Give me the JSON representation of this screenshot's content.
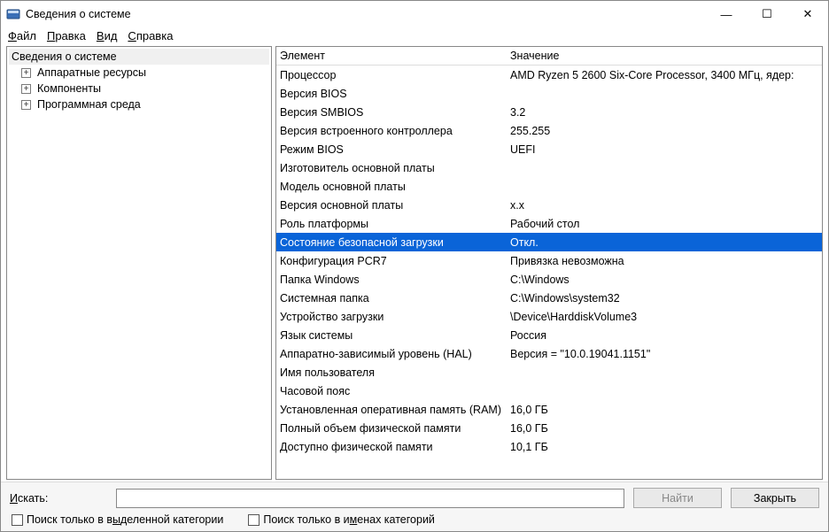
{
  "window": {
    "title": "Сведения о системе",
    "btn_min": "—",
    "btn_max": "☐",
    "btn_close": "✕"
  },
  "menu": {
    "file": {
      "u": "Ф",
      "rest": "айл"
    },
    "edit": {
      "u": "П",
      "rest": "равка"
    },
    "view": {
      "u": "В",
      "rest": "ид"
    },
    "help": {
      "u": "С",
      "rest": "правка"
    }
  },
  "tree": {
    "root": "Сведения о системе",
    "items": [
      "Аппаратные ресурсы",
      "Компоненты",
      "Программная среда"
    ]
  },
  "columns": {
    "element": "Элемент",
    "value": "Значение"
  },
  "rows": [
    {
      "k": "Процессор",
      "v": "AMD Ryzen 5 2600 Six-Core Processor, 3400 МГц, ядер:"
    },
    {
      "k": "Версия BIOS",
      "v": ""
    },
    {
      "k": "Версия SMBIOS",
      "v": "3.2"
    },
    {
      "k": "Версия встроенного контроллера",
      "v": "255.255"
    },
    {
      "k": "Режим BIOS",
      "v": "UEFI"
    },
    {
      "k": "Изготовитель основной платы",
      "v": ""
    },
    {
      "k": "Модель основной платы",
      "v": ""
    },
    {
      "k": "Версия основной платы",
      "v": "x.x"
    },
    {
      "k": "Роль платформы",
      "v": "Рабочий стол"
    },
    {
      "k": "Состояние безопасной загрузки",
      "v": "Откл.",
      "selected": true
    },
    {
      "k": "Конфигурация PCR7",
      "v": "Привязка невозможна"
    },
    {
      "k": "Папка Windows",
      "v": "C:\\Windows"
    },
    {
      "k": "Системная папка",
      "v": "C:\\Windows\\system32"
    },
    {
      "k": "Устройство загрузки",
      "v": "\\Device\\HarddiskVolume3"
    },
    {
      "k": "Язык системы",
      "v": "Россия"
    },
    {
      "k": "Аппаратно-зависимый уровень (HAL)",
      "v": "Версия = \"10.0.19041.1151\""
    },
    {
      "k": "Имя пользователя",
      "v": ""
    },
    {
      "k": "Часовой пояс",
      "v": ""
    },
    {
      "k": "Установленная оперативная память (RAM)",
      "v": "16,0 ГБ"
    },
    {
      "k": "Полный объем физической памяти",
      "v": "16,0 ГБ"
    },
    {
      "k": "Доступно физической памяти",
      "v": "10,1 ГБ"
    }
  ],
  "footer": {
    "search_label_u": "И",
    "search_label_rest": "скать:",
    "find_btn": "Найти",
    "close_u": "З",
    "close_rest": "акрыть",
    "chk1_pre": "Поиск только в в",
    "chk1_u": "ы",
    "chk1_post": "деленной категории",
    "chk2_pre": "Поиск только в и",
    "chk2_u": "м",
    "chk2_post": "енах категорий"
  }
}
